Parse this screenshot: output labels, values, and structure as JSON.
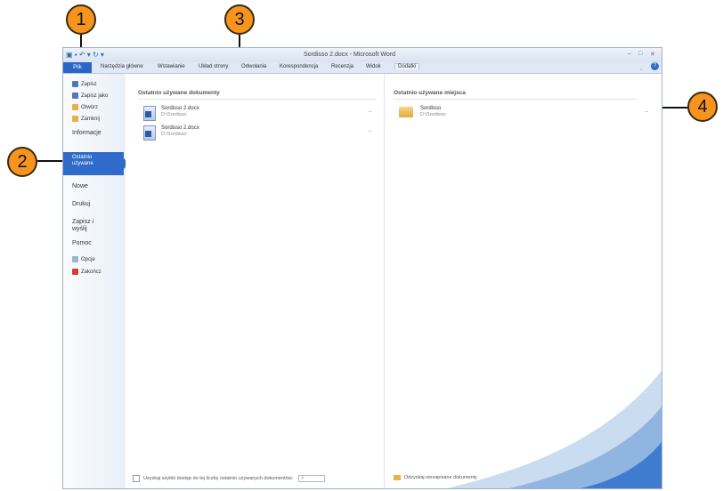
{
  "window": {
    "title": "Sordisso 2.docx - Microsoft Word",
    "quick_access": "▣ ▪ ↶ ▾ ↻ ▾",
    "controls": {
      "minimize": "–",
      "restore": "□",
      "close": "✕"
    },
    "ribbon_min": "‸",
    "help": "?"
  },
  "ribbon": {
    "tabs": [
      {
        "label": "Plik"
      },
      {
        "label": "Narzędzia główne"
      },
      {
        "label": "Wstawianie"
      },
      {
        "label": "Układ strony"
      },
      {
        "label": "Odwołania"
      },
      {
        "label": "Korespondencja"
      },
      {
        "label": "Recenzja"
      },
      {
        "label": "Widok"
      },
      {
        "label": "Dodatki"
      }
    ]
  },
  "sidebar": {
    "commands": [
      {
        "label": "Zapisz"
      },
      {
        "label": "Zapisz jako"
      },
      {
        "label": "Otwórz"
      },
      {
        "label": "Zamknij"
      }
    ],
    "sections": {
      "info": "Informacje",
      "recent": "Ostatnio używane",
      "new": "Nowe",
      "print": "Drukuj",
      "save_send": "Zapisz i wyślij",
      "help": "Pomoc"
    },
    "bottom": [
      {
        "label": "Opcje"
      },
      {
        "label": "Zakończ"
      }
    ]
  },
  "recent_docs": {
    "header": "Ostatnio używane dokumenty",
    "items": [
      {
        "name": "Sordisso 2.docx",
        "path": "D:\\Sordisso"
      },
      {
        "name": "Sordisso 2.docx",
        "path": "D:\\Sordisso"
      }
    ],
    "quick_access_label": "Uzyskaj szybki dostęp do tej liczby ostatnio używanych dokumentów:",
    "quick_access_value": "4"
  },
  "recent_places": {
    "header": "Ostatnio używane miejsca",
    "items": [
      {
        "name": "Sordisso",
        "path": "D:\\Sordisso"
      }
    ],
    "recover_label": "Odzyskaj niezapisane dokumenty"
  },
  "callouts": [
    "1",
    "2",
    "3",
    "4"
  ],
  "colors": {
    "accent": "#2f6bc8",
    "callout": "#f7941d"
  }
}
